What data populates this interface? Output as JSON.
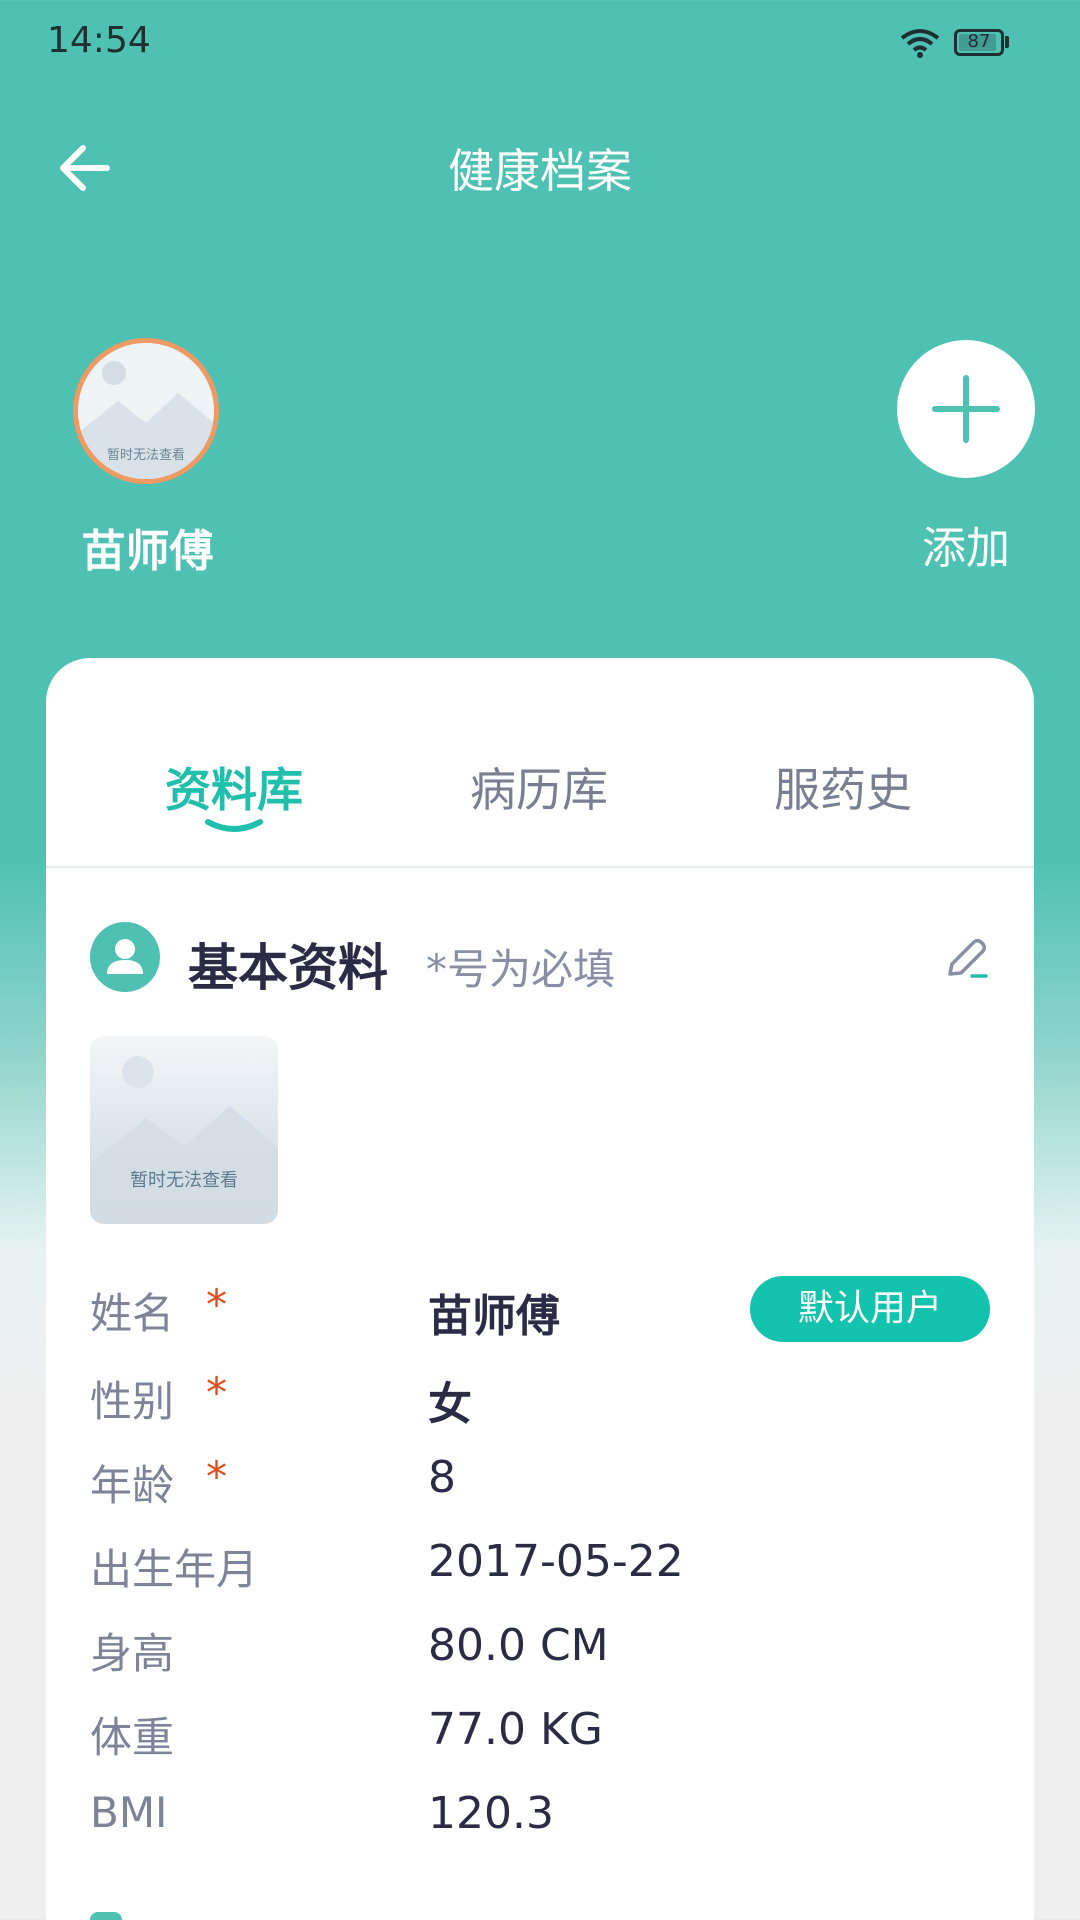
{
  "status_bar": {
    "time": "14:54",
    "battery": "87",
    "battery_level": 0.87
  },
  "header": {
    "title": "健康档案"
  },
  "profile": {
    "name": "苗师傅",
    "avatar_placeholder": "暂时无法查看",
    "add_label": "添加"
  },
  "tabs": [
    {
      "label": "资料库",
      "active": true
    },
    {
      "label": "病历库",
      "active": false
    },
    {
      "label": "服药史",
      "active": false
    }
  ],
  "section": {
    "title": "基本资料",
    "hint": "*号为必填",
    "photo_placeholder": "暂时无法查看"
  },
  "required_mark": "*",
  "fields": [
    {
      "label": "姓名",
      "value": "苗师傅",
      "required": true
    },
    {
      "label": "性别",
      "value": "女",
      "required": true
    },
    {
      "label": "年龄",
      "value": "8",
      "required": true
    },
    {
      "label": "出生年月",
      "value": "2017-05-22",
      "required": false
    },
    {
      "label": "身高",
      "value": "80.0 CM",
      "required": false
    },
    {
      "label": "体重",
      "value": "77.0 KG",
      "required": false
    },
    {
      "label": "BMI",
      "value": "120.3",
      "required": false
    }
  ],
  "default_badge": "默认用户",
  "colors": {
    "primary": "#4fc1b3",
    "accent": "#1fbfac",
    "required": "#e14c1b",
    "avatar_border": "#ef9a62"
  }
}
